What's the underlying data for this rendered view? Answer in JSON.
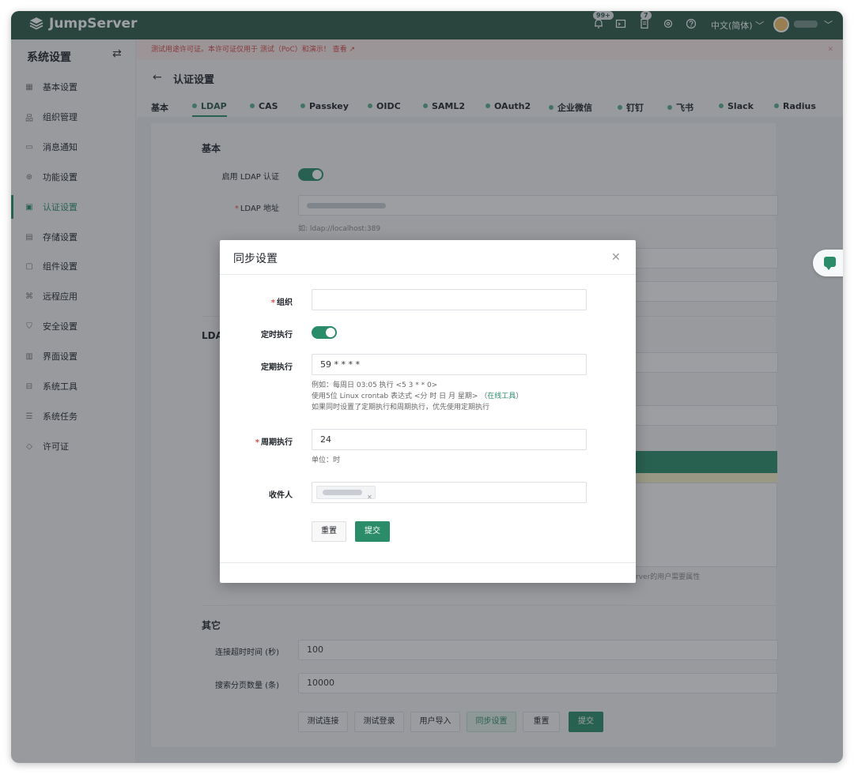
{
  "app": {
    "brand": "JumpServer"
  },
  "topbar": {
    "notifications_badge": "99+",
    "tasks_badge": "7",
    "language": "中文(简体)"
  },
  "sidebar": {
    "title": "系统设置",
    "items": [
      {
        "label": "基本设置",
        "icon": "grid-icon"
      },
      {
        "label": "组织管理",
        "icon": "org-icon"
      },
      {
        "label": "消息通知",
        "icon": "message-icon"
      },
      {
        "label": "功能设置",
        "icon": "feature-icon"
      },
      {
        "label": "认证设置",
        "icon": "auth-icon",
        "active": true
      },
      {
        "label": "存储设置",
        "icon": "storage-icon"
      },
      {
        "label": "组件设置",
        "icon": "component-icon"
      },
      {
        "label": "远程应用",
        "icon": "remote-icon"
      },
      {
        "label": "安全设置",
        "icon": "shield-icon"
      },
      {
        "label": "界面设置",
        "icon": "interface-icon"
      },
      {
        "label": "系统工具",
        "icon": "toolbox-icon"
      },
      {
        "label": "系统任务",
        "icon": "task-icon"
      },
      {
        "label": "许可证",
        "icon": "license-icon"
      }
    ]
  },
  "notice": {
    "text": "测试用途许可证。本许可证仅用于 测试（PoC）和演示！ 查看 ↗"
  },
  "page": {
    "title": "认证设置",
    "tabs": [
      {
        "label": "基本",
        "dot": false
      },
      {
        "label": "LDAP",
        "dot": true,
        "active": true
      },
      {
        "label": "CAS",
        "dot": true
      },
      {
        "label": "Passkey",
        "dot": true
      },
      {
        "label": "OIDC",
        "dot": true
      },
      {
        "label": "SAML2",
        "dot": true
      },
      {
        "label": "OAuth2",
        "dot": true
      },
      {
        "label": "企业微信",
        "dot": true
      },
      {
        "label": "钉钉",
        "dot": true
      },
      {
        "label": "飞书",
        "dot": true
      },
      {
        "label": "Slack",
        "dot": true
      },
      {
        "label": "Radius",
        "dot": true
      }
    ]
  },
  "ldap_form": {
    "basic_title": "基本",
    "enable_label": "启用 LDAP 认证",
    "address_label": "LDAP 地址",
    "address_hint": "如: ldap://localhost:389",
    "ldap_section_partial": "LDA",
    "trailing_hint_partial": "rver的用户需要属性",
    "other_title": "其它",
    "timeout_label": "连接超时时间 (秒)",
    "timeout_value": "100",
    "page_size_label": "搜索分页数量 (条)",
    "page_size_value": "10000",
    "buttons": {
      "test_connection": "测试连接",
      "test_login": "测试登录",
      "user_import": "用户导入",
      "sync_settings": "同步设置",
      "reset": "重置",
      "submit": "提交"
    }
  },
  "dialog": {
    "title": "同步设置",
    "org_label": "组织",
    "timer_label": "定时执行",
    "crontab_label": "定期执行",
    "crontab_value": "59 * * * *",
    "crontab_hint_1": "例如：每周日 03:05 执行 <5 3 * * 0>",
    "crontab_hint_2_prefix": "使用5位 Linux crontab 表达式 <分 时 日 月 星期> （",
    "crontab_hint_2_link": "在线工具",
    "crontab_hint_2_suffix": "）",
    "crontab_hint_3": "如果同时设置了定期执行和周期执行，优先使用定期执行",
    "interval_label": "周期执行",
    "interval_value": "24",
    "interval_unit": "单位：时",
    "recipients_label": "收件人",
    "reset_button": "重置",
    "submit_button": "提交"
  },
  "colors": {
    "brand_dark": "#2a5a48",
    "accent": "#2a8c68",
    "notice_text": "#d74545"
  }
}
